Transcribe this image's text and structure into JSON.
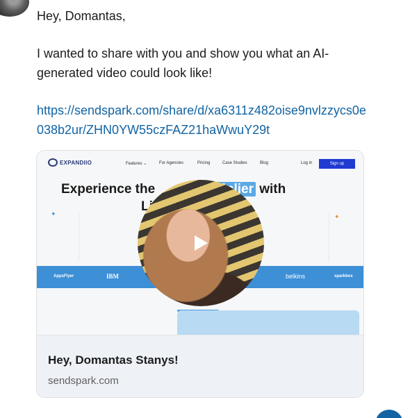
{
  "message": {
    "greeting": "Hey, Domantas,",
    "body": "I wanted to share with you and show you what an AI-generated video could look like!",
    "link": "https://sendspark.com/share/d/xa6311z482oise9nvlzzycs0e038b2ur/ZHN0YW55czFAZ21haWwuY29t"
  },
  "preview": {
    "site": {
      "logo": "EXPANDIIO",
      "nav": [
        "Features ⌄",
        "For Agencies",
        "Pricing",
        "Case Studies",
        "Blog"
      ],
      "login": "Log in",
      "signup": "Sign up",
      "hero_prefix": "Experience the",
      "hero_highlight": "multiplier",
      "hero_suffix": "with",
      "hero_line2": "Li                    i",
      "brands": [
        "AppsFlyer",
        "IBM",
        "belkins",
        "sparkbox"
      ]
    },
    "video": {
      "control": "play-icon"
    },
    "title": "Hey, Domantas Stanys!",
    "domain": "sendspark.com"
  },
  "colors": {
    "link": "#1264a3",
    "accent": "#3d8fd6",
    "signup": "#1f3bd1"
  }
}
